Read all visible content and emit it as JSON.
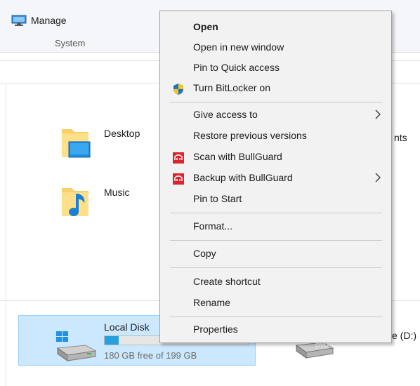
{
  "ribbon": {
    "manage_label": "Manage",
    "group_label": "System"
  },
  "folders": [
    {
      "label": "Desktop",
      "icon": "desktop-folder-icon"
    },
    {
      "label": "Music",
      "icon": "music-folder-icon"
    }
  ],
  "hidden_fragment": "nts",
  "drive": {
    "name": "Local Disk",
    "free_text": "180 GB free of 199 GB",
    "used_fraction": 0.1,
    "icon": "windows-drive-icon"
  },
  "dvd": {
    "label_fragment": "e (D:)",
    "badge": "DVD",
    "icon": "dvd-drive-icon"
  },
  "context_menu": {
    "items": [
      {
        "label": "Open",
        "bold": true
      },
      {
        "label": "Open in new window"
      },
      {
        "label": "Pin to Quick access"
      },
      {
        "label": "Turn BitLocker on",
        "icon": "shield-icon"
      },
      {
        "label": "Give access to",
        "submenu": true
      },
      {
        "label": "Restore previous versions"
      },
      {
        "label": "Scan with BullGuard",
        "icon": "bullguard-icon"
      },
      {
        "label": "Backup with BullGuard",
        "icon": "bullguard-icon",
        "submenu": true
      },
      {
        "label": "Pin to Start"
      },
      {
        "label": "Format..."
      },
      {
        "label": "Copy"
      },
      {
        "label": "Create shortcut"
      },
      {
        "label": "Rename"
      },
      {
        "label": "Properties"
      }
    ]
  },
  "colors": {
    "selection_bg": "#cce8ff",
    "drive_bar_fill": "#26a0da",
    "menu_bg": "#f2f2f2",
    "bullguard_red": "#d9262e",
    "shield_blue": "#1f6fd1",
    "shield_yellow": "#f5c518"
  }
}
